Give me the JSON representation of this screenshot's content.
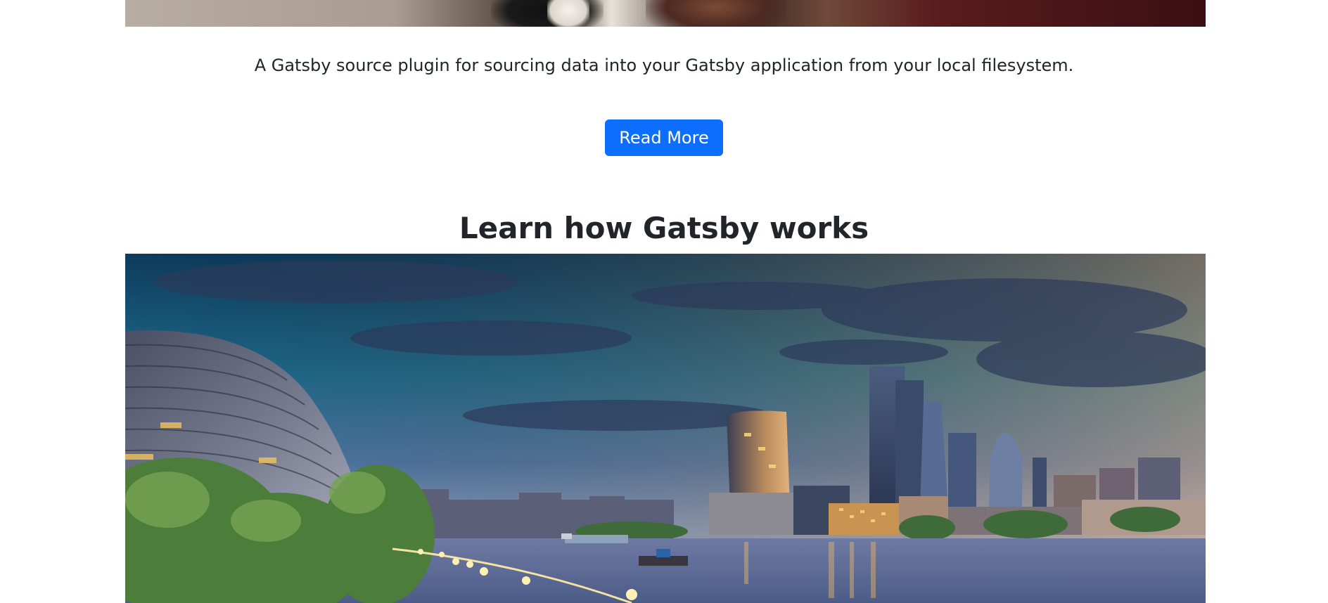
{
  "card": {
    "description": "A Gatsby source plugin for sourcing data into your Gatsby application from your local filesystem.",
    "button_label": "Read More"
  },
  "section": {
    "title": "Learn how Gatsby works"
  },
  "colors": {
    "primary": "#0d6efd",
    "text": "#212529",
    "background": "#ffffff"
  }
}
